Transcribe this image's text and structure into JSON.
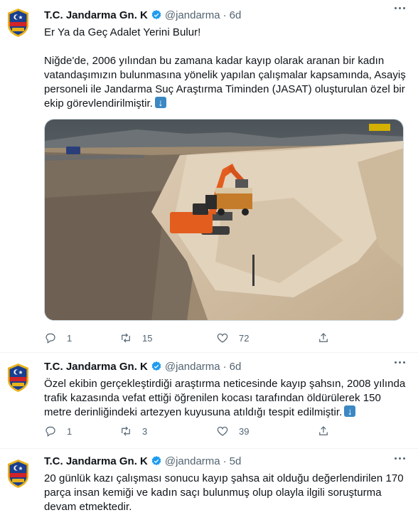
{
  "tweets": [
    {
      "author_name": "T.C. Jandarma Gn. K",
      "handle": "@jandarma",
      "separator": "·",
      "time": "6d",
      "paragraphs": [
        "Er Ya da Geç Adalet Yerini Bulur!",
        "Niğde'de, 2006 yılından bu zamana kadar kayıp olarak aranan bir kadın vatandaşımızın bulunmasına yönelik yapılan çalışmalar kapsamında, Asayiş personeli ile Jandarma Suç Araştırma Timinden (JASAT) oluşturulan özel bir ekip görevlendirilmiştir."
      ],
      "has_arrow_emoji": true,
      "replies": "1",
      "retweets": "15",
      "likes": "72"
    },
    {
      "author_name": "T.C. Jandarma Gn. K",
      "handle": "@jandarma",
      "separator": "·",
      "time": "6d",
      "paragraphs": [
        "Özel ekibin gerçekleştirdiği araştırma neticesinde kayıp şahsın, 2008 yılında trafik kazasında vefat ettiği öğrenilen kocası tarafından öldürülerek 150 metre derinliğindeki artezyen kuyusuna atıldığı tespit edilmiştir."
      ],
      "has_arrow_emoji": true,
      "replies": "1",
      "retweets": "3",
      "likes": "39"
    },
    {
      "author_name": "T.C. Jandarma Gn. K",
      "handle": "@jandarma",
      "separator": "·",
      "time": "5d",
      "paragraphs": [
        "20 günlük kazı çalışması sonucu kayıp şahsa ait olduğu değerlendirilen 170 parça insan kemiği ve kadın saçı bulunmuş olup olayla ilgili soruşturma devam etmektedir."
      ]
    }
  ],
  "colors": {
    "verified": "#1d9bf0",
    "secondary_text": "#536471",
    "emblem_blue": "#1a3f8f",
    "emblem_red": "#d1232a",
    "emblem_gold": "#e8b21a"
  },
  "icons": [
    "reply-icon",
    "retweet-icon",
    "like-icon",
    "share-icon",
    "verified-badge-icon",
    "more-options-icon",
    "arrow-down-emoji"
  ]
}
